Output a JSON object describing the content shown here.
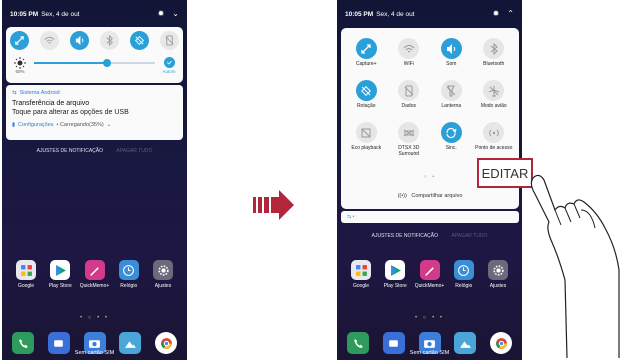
{
  "left_screen": {
    "status": {
      "time": "10:05 PM",
      "date": "Sex, 4 de out"
    },
    "brightness": {
      "percent_label": "60%",
      "level": 0.6,
      "auto_label": "Autom"
    },
    "notification": {
      "app_name": "Sistema Android",
      "title": "Transferência de arquivo",
      "text": "Toque para alterar as opções de USB",
      "action_label": "Configurações",
      "status": "• Carregando(35%)"
    },
    "notif_settings": "AJUSTES DE NOTIFICAÇÃO",
    "notif_clear": "APAGAR TUDO",
    "apps": [
      {
        "label": "Google",
        "icon": "google-folder-icon"
      },
      {
        "label": "Play Store",
        "icon": "play-store-icon"
      },
      {
        "label": "QuickMemo+",
        "icon": "quickmemo-icon"
      },
      {
        "label": "Relógio",
        "icon": "clock-icon"
      },
      {
        "label": "Ajustes",
        "icon": "settings-icon"
      }
    ],
    "dock_label": "Sem cartão SIM"
  },
  "right_screen": {
    "status": {
      "time": "10:05 PM",
      "date": "Sex, 4 de out"
    },
    "tiles": [
      {
        "label": "Capture+",
        "on": true
      },
      {
        "label": "WiFi",
        "on": false
      },
      {
        "label": "Som",
        "on": true
      },
      {
        "label": "Bluetooth",
        "on": false
      },
      {
        "label": "Rotação",
        "on": true
      },
      {
        "label": "Dados",
        "on": false
      },
      {
        "label": "Lanterna",
        "on": false
      },
      {
        "label": "Modo avião",
        "on": false
      },
      {
        "label": "Eco playback",
        "on": false
      },
      {
        "label": "DTSX 3D Surround",
        "on": false
      },
      {
        "label": "Sinc.",
        "on": true
      },
      {
        "label": "Ponto de acesso",
        "on": false
      }
    ],
    "share_label": "Compartilhar arquivo",
    "notif_settings": "AJUSTES DE NOTIFICAÇÃO",
    "notif_clear": "APAGAR TUDO",
    "apps": [
      {
        "label": "Google"
      },
      {
        "label": "Play Store"
      },
      {
        "label": "QuickMemo+"
      },
      {
        "label": "Relógio"
      },
      {
        "label": "Ajustes"
      }
    ],
    "dock_label": "Sem cartão SIM"
  },
  "callout": {
    "label": "EDITAR"
  },
  "colors": {
    "accent": "#2a9fd8",
    "callout_border": "#b2263c",
    "arrow": "#b2263c"
  }
}
